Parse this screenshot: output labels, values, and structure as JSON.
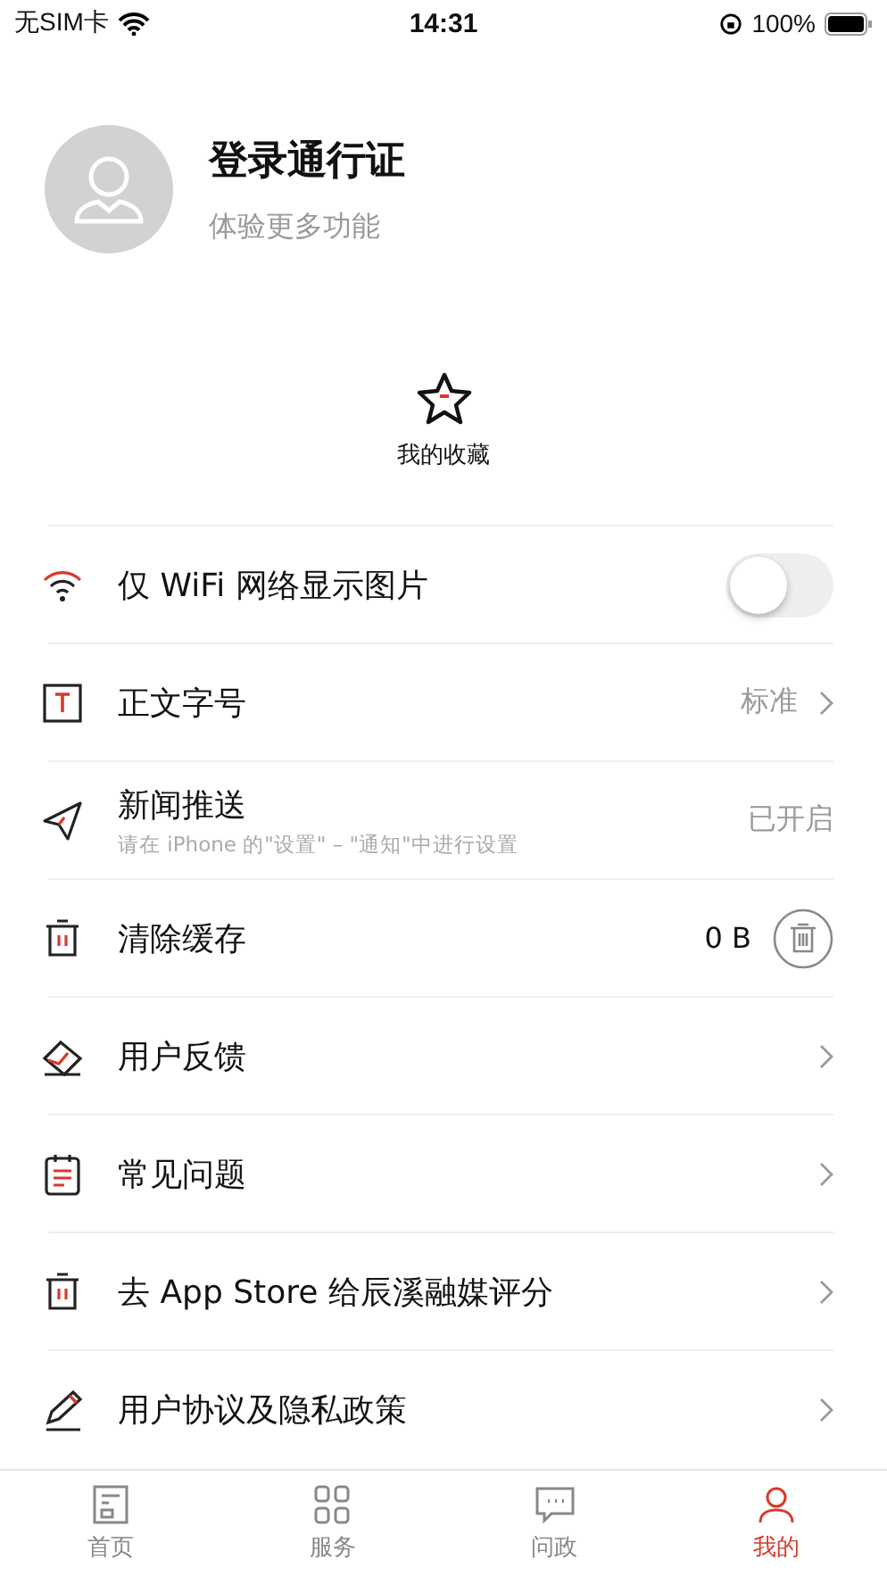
{
  "status_bar": {
    "carrier": "无SIM卡",
    "time": "14:31",
    "battery": "100%"
  },
  "profile": {
    "title": "登录通行证",
    "subtitle": "体验更多功能"
  },
  "favorites": {
    "label": "我的收藏"
  },
  "settings": [
    {
      "kind": "toggle",
      "label": "仅 WiFi 网络显示图片",
      "on": false
    },
    {
      "kind": "value",
      "label": "正文字号",
      "value": "标准",
      "chevron": true
    },
    {
      "kind": "value",
      "label": "新闻推送",
      "hint": "请在 iPhone 的\"设置\" – \"通知\"中进行设置",
      "value": "已开启",
      "chevron": false
    },
    {
      "kind": "clear",
      "label": "清除缓存",
      "value": "0 B"
    },
    {
      "kind": "link",
      "label": "用户反馈"
    },
    {
      "kind": "link",
      "label": "常见问题"
    },
    {
      "kind": "link",
      "label": "去 App Store 给辰溪融媒评分"
    },
    {
      "kind": "link",
      "label": "用户协议及隐私政策"
    }
  ],
  "tabs": [
    {
      "label": "首页",
      "selected": false
    },
    {
      "label": "服务",
      "selected": false
    },
    {
      "label": "问政",
      "selected": false
    },
    {
      "label": "我的",
      "selected": true
    }
  ]
}
